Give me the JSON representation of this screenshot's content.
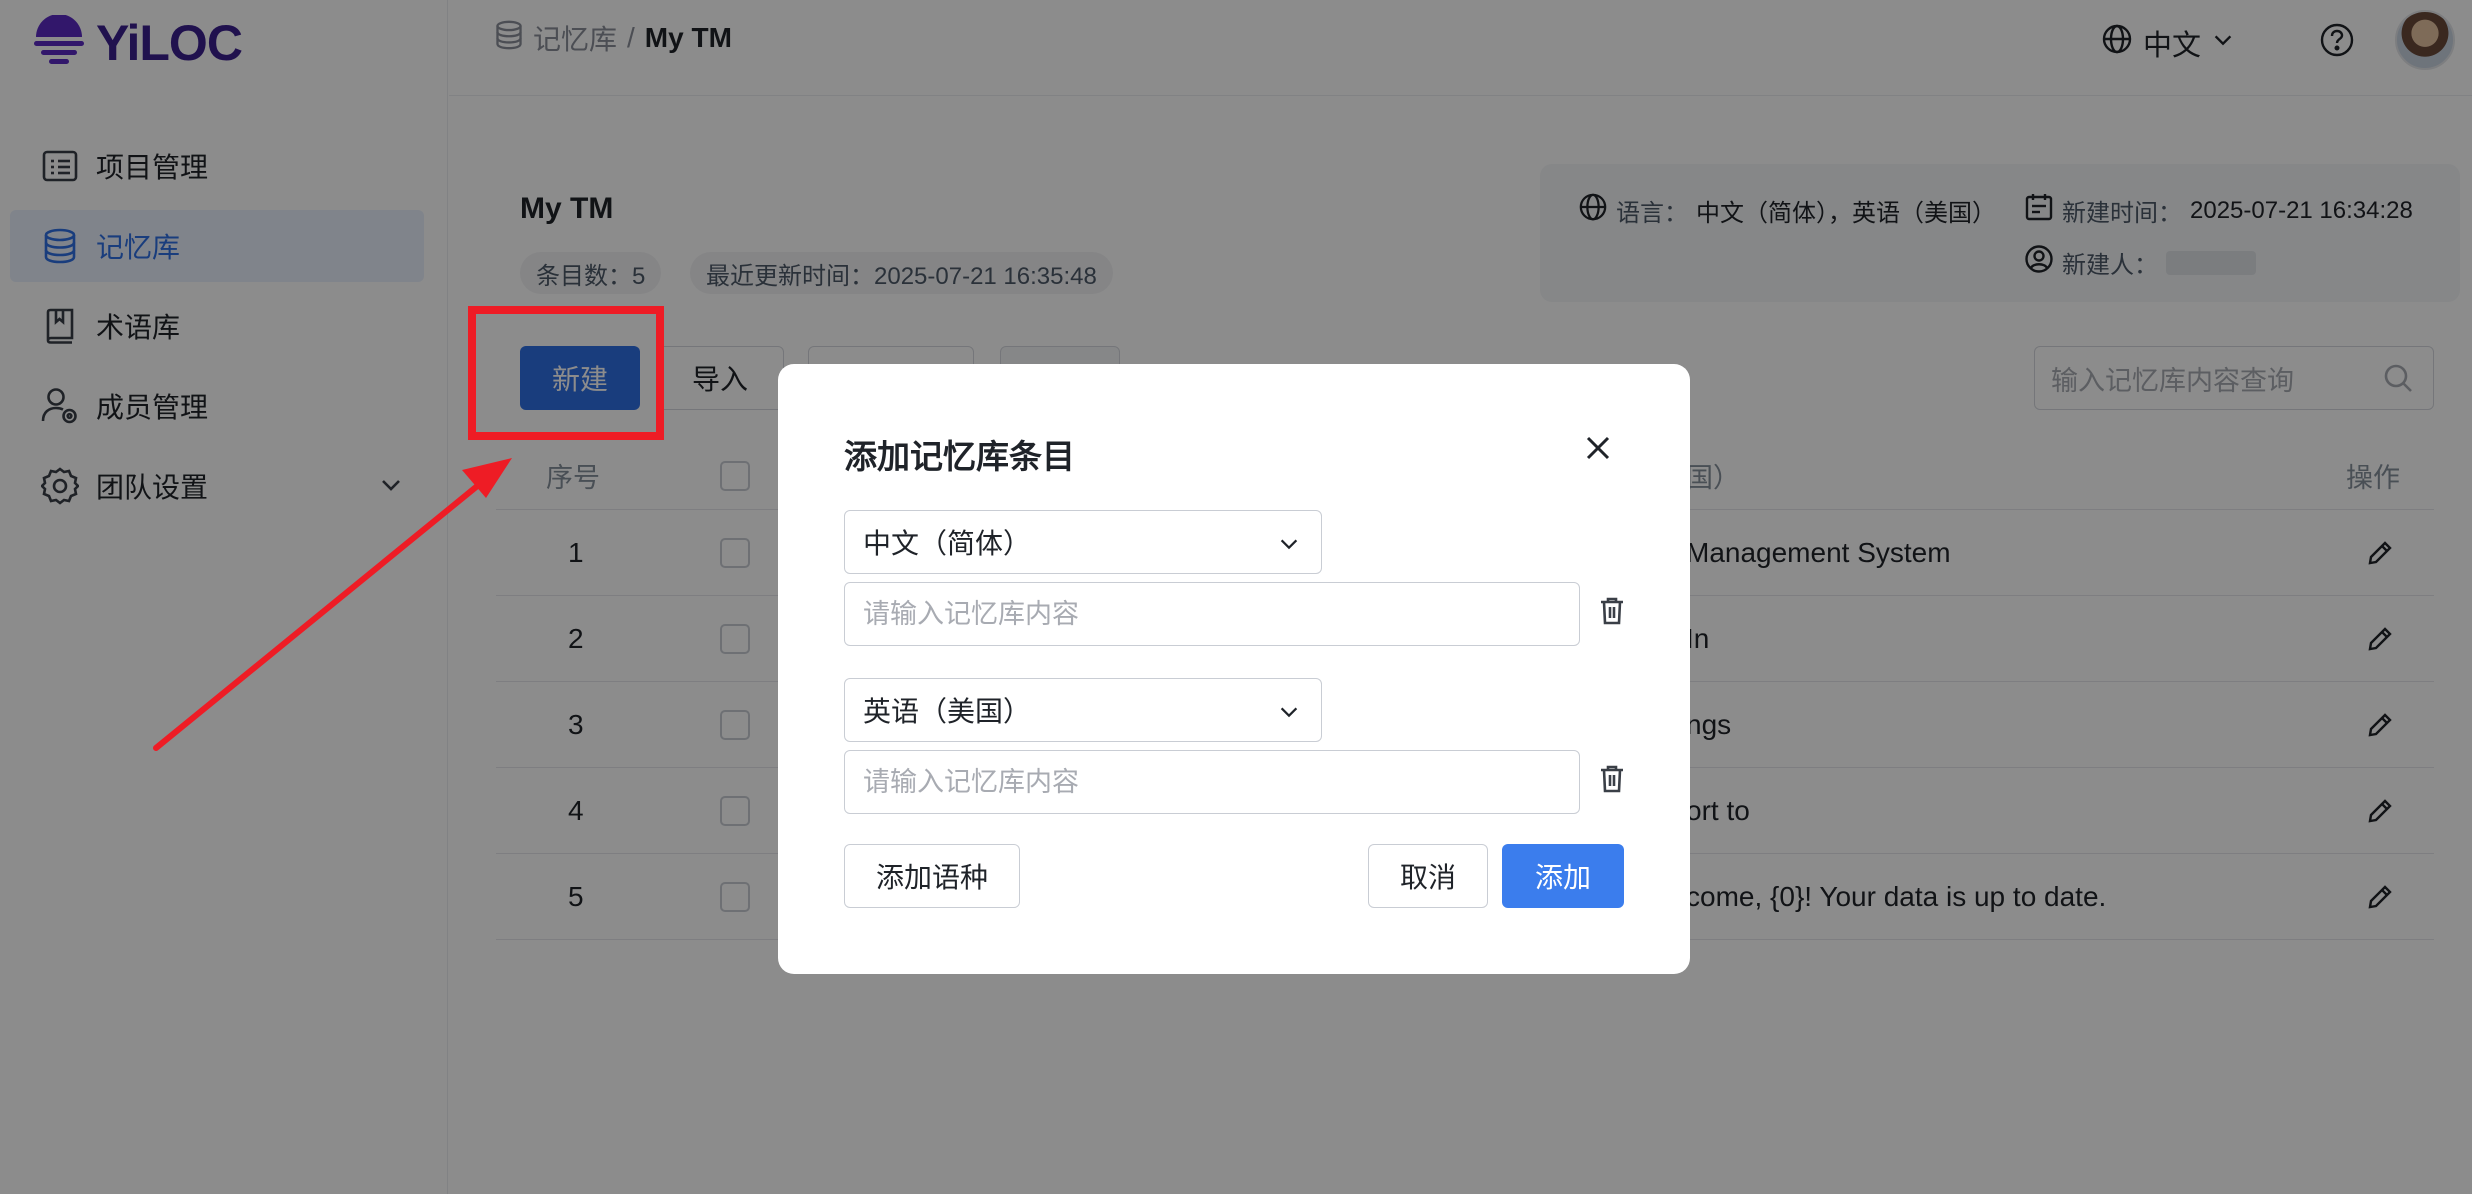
{
  "app": {
    "logo_text": "YiLOC"
  },
  "sidebar": {
    "items": [
      {
        "label": "项目管理",
        "icon": "list-icon"
      },
      {
        "label": "记忆库",
        "icon": "database-icon"
      },
      {
        "label": "术语库",
        "icon": "book-icon"
      },
      {
        "label": "成员管理",
        "icon": "user-settings-icon"
      },
      {
        "label": "团队设置",
        "icon": "gear-icon"
      }
    ],
    "active_index": 1
  },
  "header": {
    "breadcrumb_parent": "记忆库",
    "breadcrumb_separator": "/",
    "breadcrumb_current": "My TM",
    "language": "中文"
  },
  "tm": {
    "title": "My TM",
    "entry_count_label": "条目数：5",
    "last_updated_label": "最近更新时间：2025-07-21 16:35:48"
  },
  "info": {
    "language_key": "语言：",
    "language_value": "中文（简体），英语（美国）",
    "created_time_key": "新建时间：",
    "created_time_value": "2025-07-21 16:34:28",
    "creator_key": "新建人："
  },
  "toolbar": {
    "new_label": "新建",
    "import_label": "导入",
    "search_placeholder": "输入记忆库内容查询"
  },
  "table": {
    "headers": {
      "index": "序号",
      "en_partial": "国）",
      "actions": "操作"
    },
    "rows": [
      {
        "index": "1",
        "en": "Management System"
      },
      {
        "index": "2",
        "en": "In"
      },
      {
        "index": "3",
        "en": "ngs"
      },
      {
        "index": "4",
        "en": "ort to"
      },
      {
        "index": "5",
        "en": "come, {0}! Your data is up to date."
      }
    ]
  },
  "modal": {
    "title": "添加记忆库条目",
    "source_language": "中文（简体）",
    "target_language": "英语（美国）",
    "input_placeholder": "请输入记忆库内容",
    "add_language_label": "添加语种",
    "cancel_label": "取消",
    "submit_label": "添加"
  },
  "colors": {
    "primary": "#2f6fe4",
    "brand": "#3b1f8f",
    "annotation_red": "#ee1c25"
  }
}
